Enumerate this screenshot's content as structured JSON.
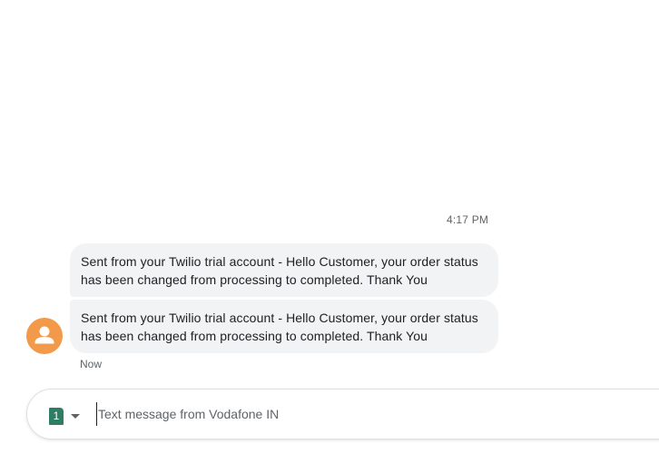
{
  "conversation": {
    "timestamp": "4:17 PM",
    "messages": [
      {
        "text": "Sent from your Twilio trial account - Hello Customer, your order status has been changed from processing to completed. Thank You"
      },
      {
        "text": "Sent from your Twilio trial account - Hello Customer, your order status has been changed from processing to completed. Thank You"
      }
    ],
    "status": "Now",
    "avatar": {
      "icon": "person-icon",
      "color": "#f2994a"
    }
  },
  "composer": {
    "sim_label": "1",
    "sim_color": "#2e7d64",
    "sim_dropdown_icon": "caret-down-icon",
    "placeholder": "Text message from Vodafone IN",
    "value": ""
  }
}
